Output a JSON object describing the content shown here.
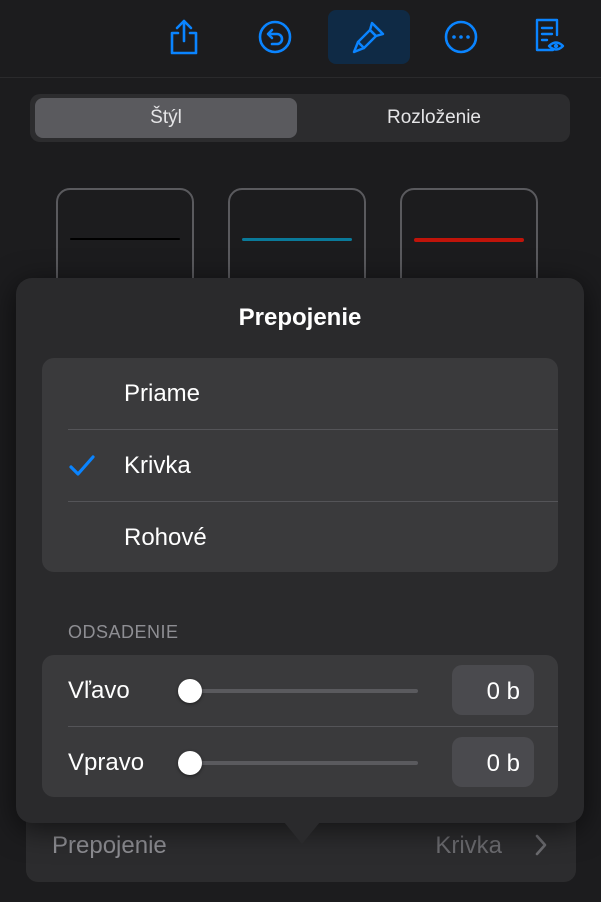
{
  "toolbar": {
    "buttons": [
      {
        "name": "share-icon"
      },
      {
        "name": "undo-icon"
      },
      {
        "name": "format-brush-icon",
        "active": true
      },
      {
        "name": "more-icon"
      },
      {
        "name": "reader-view-icon"
      }
    ],
    "accent": "#0a84ff"
  },
  "tabs": {
    "style": "Štýl",
    "layout": "Rozloženie",
    "selected": "style"
  },
  "line_styles": [
    {
      "name": "thin-black-line",
      "color": "#000000"
    },
    {
      "name": "blue-line",
      "color": "#0a7a9a"
    },
    {
      "name": "red-pencil-line",
      "color": "#c0140a"
    }
  ],
  "popover": {
    "title": "Prepojenie",
    "options": [
      "Priame",
      "Krivka",
      "Rohové"
    ],
    "selected": "Krivka",
    "section_header": "ODSADENIE",
    "sliders": [
      {
        "label": "Vľavo",
        "value": 0,
        "display": "0 b"
      },
      {
        "label": "Vpravo",
        "value": 0,
        "display": "0 b"
      }
    ]
  },
  "connection_row": {
    "label": "Prepojenie",
    "value": "Krivka"
  }
}
